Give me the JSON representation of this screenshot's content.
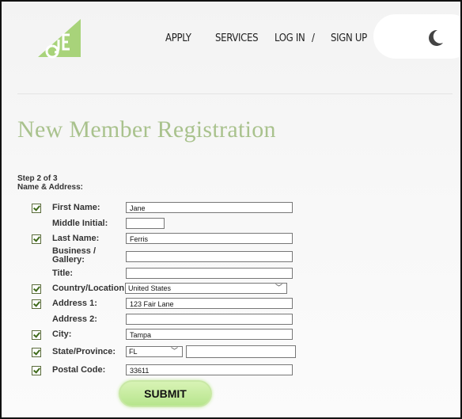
{
  "header": {
    "nav": [
      "APPLY",
      "SERVICES",
      "LOG IN",
      "/",
      "SIGN UP"
    ]
  },
  "title": "New Member Registration",
  "step": {
    "line1": "Step 2 of 3",
    "line2": "Name & Address:"
  },
  "fields": {
    "first_name": {
      "label": "First Name:",
      "value": "Jane"
    },
    "middle_initial": {
      "label": "Middle Initial:",
      "value": ""
    },
    "last_name": {
      "label": "Last Name:",
      "value": "Ferris"
    },
    "business": {
      "label_1": "Business /",
      "label_2": "Gallery:",
      "value": ""
    },
    "title": {
      "label": "Title:",
      "value": ""
    },
    "country": {
      "label": "Country/Location:",
      "value": "United States"
    },
    "address1": {
      "label": "Address 1:",
      "value": "123 Fair Lane"
    },
    "address2": {
      "label": "Address 2:",
      "value": ""
    },
    "city": {
      "label": "City:",
      "value": "Tampa"
    },
    "state": {
      "label": "State/Province:",
      "value": "FL",
      "other_value": ""
    },
    "postal": {
      "label": "Postal Code:",
      "value": "33611"
    }
  },
  "submit_label": "SUBMIT",
  "colors": {
    "title": "#a9c28d",
    "submit": "#b7e58d",
    "logo": "#a8d37a"
  },
  "icons": {
    "logo": "oje-logo",
    "theme": "moon-icon",
    "check": "checkbox-checked-icon"
  }
}
